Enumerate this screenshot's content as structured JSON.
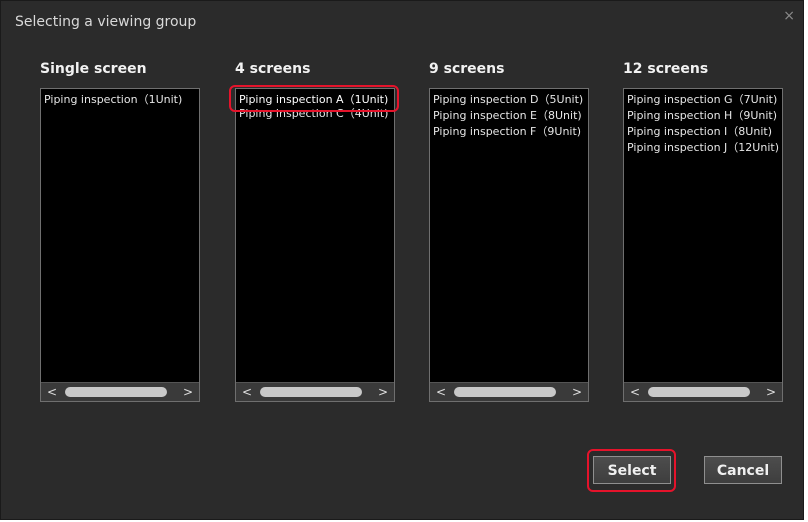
{
  "dialog": {
    "title": "Selecting a viewing group",
    "close_glyph": "×"
  },
  "columns": [
    {
      "title": "Single screen",
      "items": [
        "Piping inspection（1Unit)"
      ]
    },
    {
      "title": "4 screens",
      "items": [
        "Piping inspection A（1Unit)",
        "Piping inspection C（4Unit)"
      ],
      "selected_index": 0
    },
    {
      "title": "9 screens",
      "items": [
        "Piping inspection D（5Unit)",
        "Piping inspection E（8Unit)",
        "Piping inspection F（9Unit)"
      ]
    },
    {
      "title": "12 screens",
      "items": [
        "Piping inspection G（7Unit)",
        "Piping inspection H（9Unit)",
        "Piping inspection I（8Unit)",
        "Piping inspection J（12Unit)"
      ]
    }
  ],
  "scroll": {
    "left_glyph": "<",
    "right_glyph": ">"
  },
  "buttons": {
    "select": "Select",
    "cancel": "Cancel"
  },
  "colors": {
    "highlight": "#e5132b",
    "background": "#2b2b2b",
    "list_background": "#000000"
  }
}
